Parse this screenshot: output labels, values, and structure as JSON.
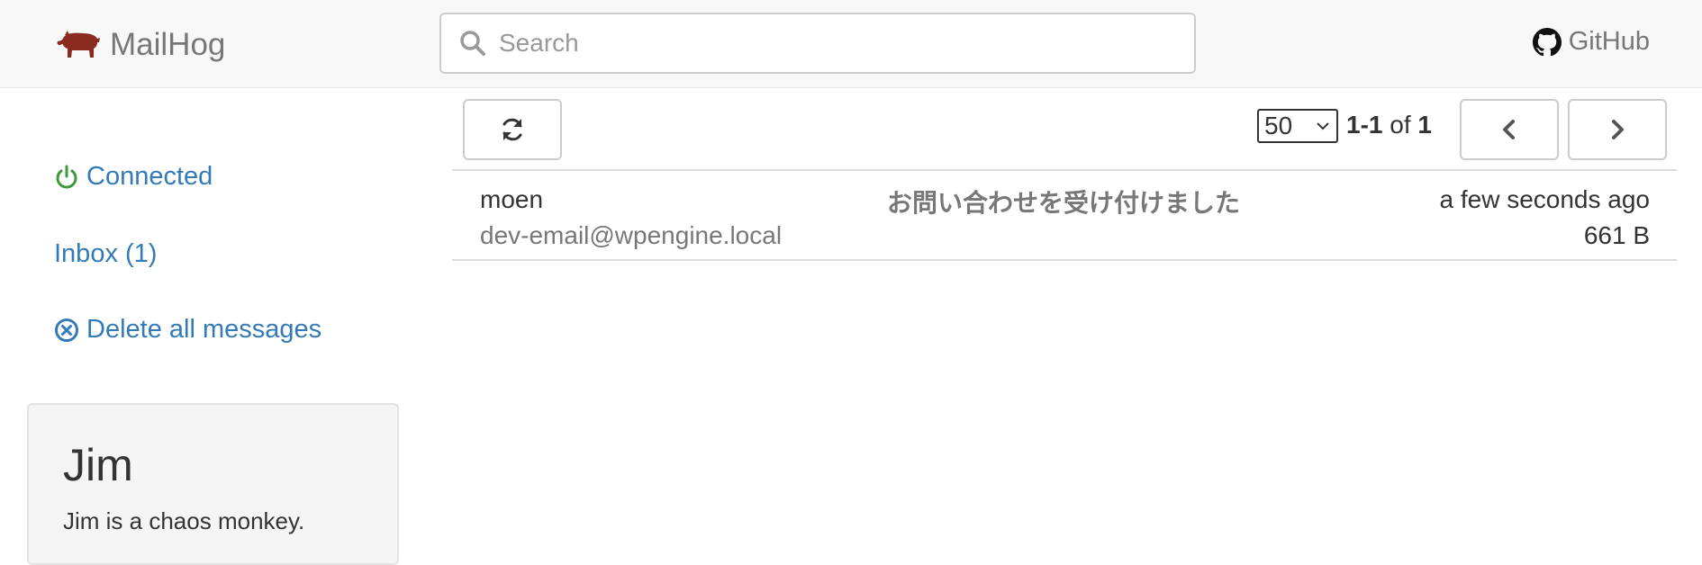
{
  "navbar": {
    "brand": "MailHog",
    "search_placeholder": "Search",
    "github_label": "GitHub"
  },
  "sidebar": {
    "connected_label": "Connected",
    "inbox_label": "Inbox (1)",
    "delete_all_label": "Delete all messages",
    "jim": {
      "title": "Jim",
      "description": "Jim is a chaos monkey."
    }
  },
  "toolbar": {
    "page_size": "50",
    "range": "1-1",
    "of_label": "of",
    "total": "1"
  },
  "messages": [
    {
      "from": "moen",
      "to": "dev-email@wpengine.local",
      "subject": "お問い合わせを受け付けました",
      "time": "a few seconds ago",
      "size": "661 B"
    }
  ],
  "colors": {
    "link": "#337ab7",
    "connected": "#3c9a3c",
    "brand_pig": "#8b2a1f"
  }
}
